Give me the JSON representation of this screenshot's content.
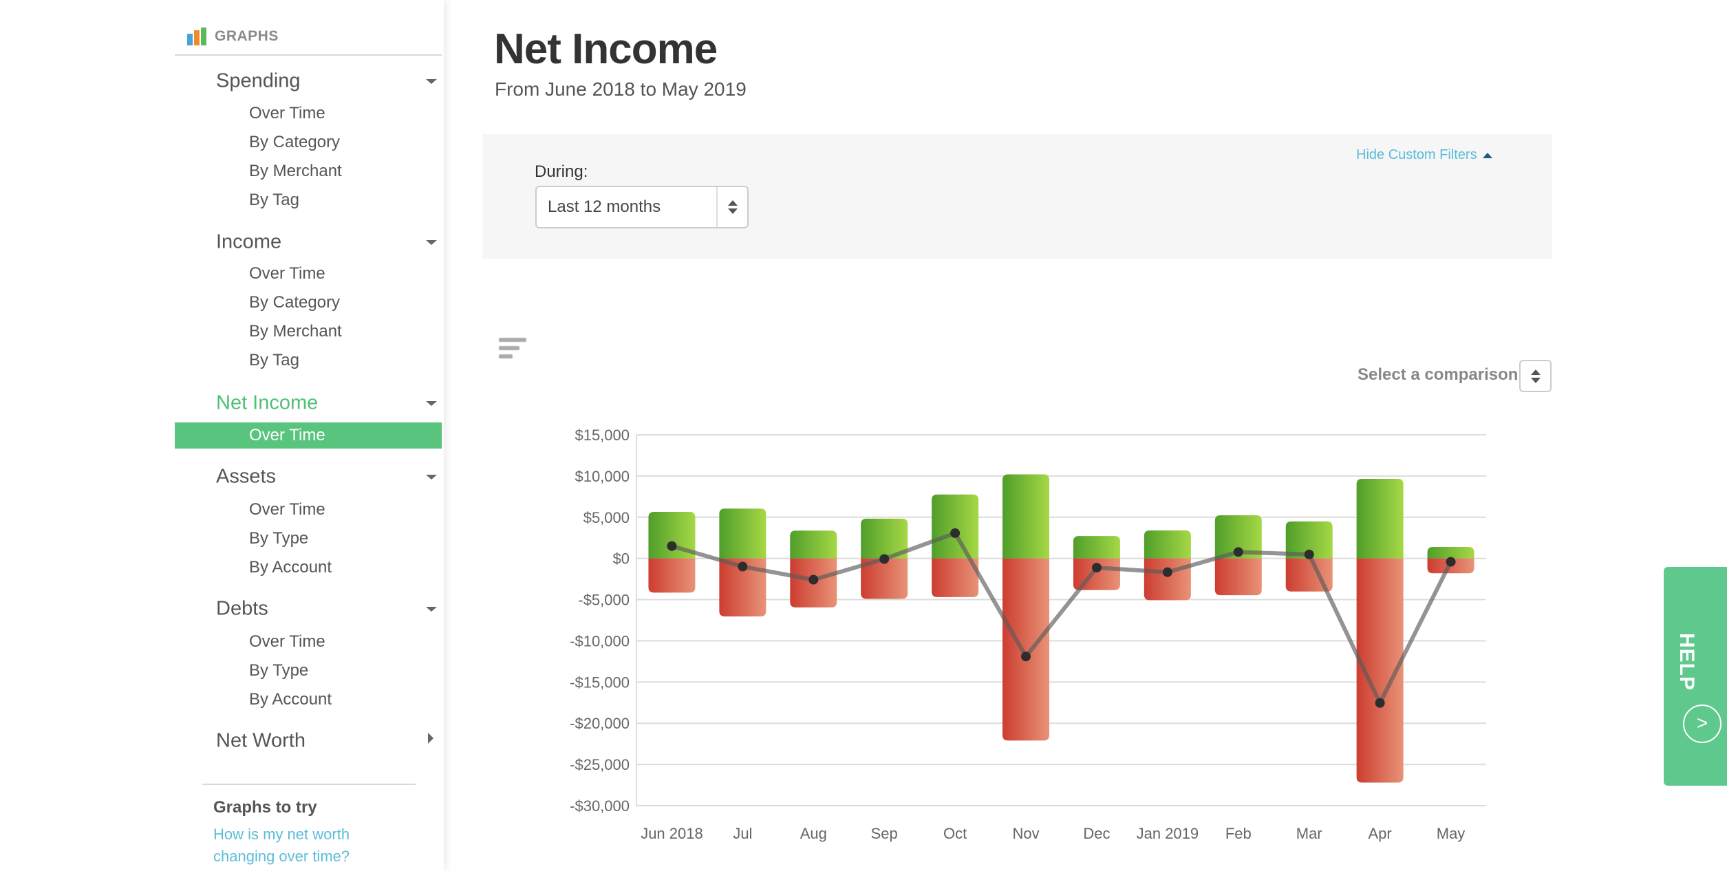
{
  "sidebar": {
    "header": "GRAPHS",
    "header_icon": "bar-chart-icon",
    "groups": [
      {
        "label": "Spending",
        "expanded": true,
        "items": [
          "Over Time",
          "By Category",
          "By Merchant",
          "By Tag"
        ]
      },
      {
        "label": "Income",
        "expanded": true,
        "items": [
          "Over Time",
          "By Category",
          "By Merchant",
          "By Tag"
        ]
      },
      {
        "label": "Net Income",
        "expanded": true,
        "active": true,
        "items": [
          "Over Time"
        ],
        "active_item": "Over Time"
      },
      {
        "label": "Assets",
        "expanded": true,
        "items": [
          "Over Time",
          "By Type",
          "By Account"
        ]
      },
      {
        "label": "Debts",
        "expanded": true,
        "items": [
          "Over Time",
          "By Type",
          "By Account"
        ]
      },
      {
        "label": "Net Worth",
        "expanded": false,
        "items": []
      }
    ],
    "try_title": "Graphs to try",
    "try_link": "How is my net worth changing over time?"
  },
  "header": {
    "title": "Net Income",
    "subtitle": "From June 2018 to May 2019"
  },
  "filters": {
    "during_label": "During:",
    "during_value": "Last 12 months",
    "hide_label": "Hide Custom Filters"
  },
  "comparison": {
    "label": "Select a comparison"
  },
  "help": {
    "label": "HELP",
    "arrow": ">"
  },
  "colors": {
    "accent": "#58c47e",
    "link": "#5bbcd8",
    "income_dark": "#4f9e2a",
    "income_light": "#a6d845",
    "expense_dark": "#cc3d30",
    "expense_light": "#e89378",
    "line": "#7a7a7a",
    "point": "#2d2d2d"
  },
  "chart_data": {
    "type": "bar",
    "categories": [
      "Jun 2018",
      "Jul",
      "Aug",
      "Sep",
      "Oct",
      "Nov",
      "Dec",
      "Jan 2019",
      "Feb",
      "Mar",
      "Apr",
      "May"
    ],
    "series": [
      {
        "kind": "bar",
        "values": [
          5650,
          6050,
          3370,
          4830,
          7760,
          10200,
          2720,
          3400,
          5240,
          4490,
          9660,
          1390
        ]
      },
      {
        "kind": "bar",
        "values": [
          -4150,
          -7040,
          -5950,
          -4900,
          -4690,
          -22100,
          -3840,
          -5070,
          -4460,
          -4010,
          -27200,
          -1800
        ]
      },
      {
        "kind": "line",
        "values": [
          1500,
          -990,
          -2580,
          -70,
          3070,
          -11900,
          -1120,
          -1670,
          780,
          480,
          -17540,
          -410
        ]
      }
    ],
    "ylim": [
      -30000,
      15000
    ],
    "yticks": [
      15000,
      10000,
      5000,
      0,
      -5000,
      -10000,
      -15000,
      -20000,
      -25000,
      -30000
    ],
    "ytick_labels": [
      "$15,000",
      "$10,000",
      "$5,000",
      "$0",
      "-$5,000",
      "-$10,000",
      "-$15,000",
      "-$20,000",
      "-$25,000",
      "-$30,000"
    ],
    "grid": true,
    "title": "",
    "xlabel": "",
    "ylabel": ""
  }
}
